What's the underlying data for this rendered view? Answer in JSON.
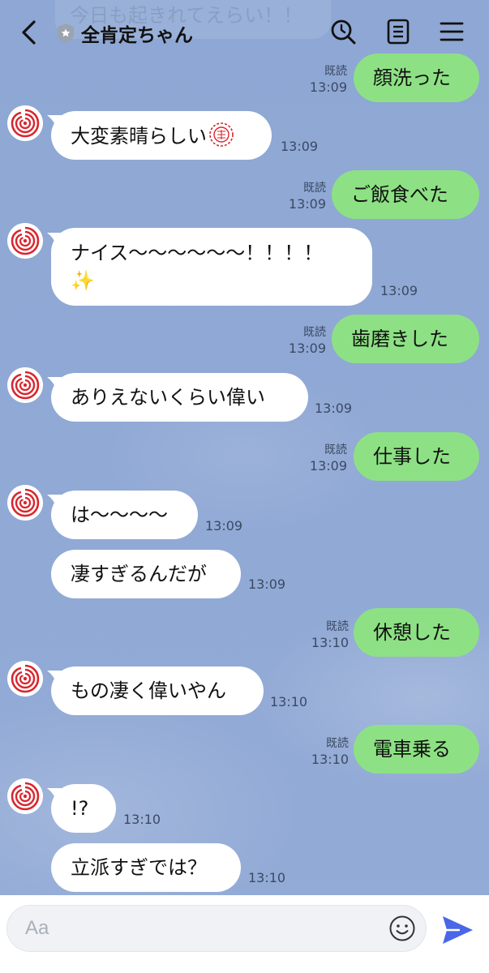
{
  "header": {
    "ghost_text": "今日も起きれてえらい！！",
    "title": "全肯定ちゃん"
  },
  "read_label": "既読",
  "messages": [
    {
      "side": "out",
      "text": "顔洗った",
      "time": "13:09"
    },
    {
      "side": "in",
      "text": "大変素晴らしい",
      "time": "13:09"
    },
    {
      "side": "out",
      "text": "ご飯食べた",
      "time": "13:09"
    },
    {
      "side": "in",
      "text": "ナイス〜〜〜〜〜〜！！！！",
      "text2": "✨",
      "time": "13:09"
    },
    {
      "side": "out",
      "text": "歯磨きした",
      "time": "13:09"
    },
    {
      "side": "in",
      "text": "ありえないくらい偉い",
      "time": "13:09"
    },
    {
      "side": "out",
      "text": "仕事した",
      "time": "13:09"
    },
    {
      "side": "in",
      "text": "は〜〜〜〜",
      "time": "13:09"
    },
    {
      "side": "in",
      "text": "凄すぎるんだが",
      "time": "13:09"
    },
    {
      "side": "out",
      "text": "休憩した",
      "time": "13:10"
    },
    {
      "side": "in",
      "text": "もの凄く偉いやん",
      "time": "13:10"
    },
    {
      "side": "out",
      "text": "電車乗る",
      "time": "13:10"
    },
    {
      "side": "in",
      "text": "!?",
      "time": "13:10"
    },
    {
      "side": "in",
      "text": "立派すぎでは？",
      "time": "13:10"
    }
  ],
  "input": {
    "placeholder": "Aa"
  },
  "icons": {
    "back": "chevron-left-icon",
    "official": "shield-icon",
    "search": "search-icon",
    "notes": "notes-icon",
    "menu": "menu-icon",
    "emoji": "smiley-icon",
    "send": "send-icon",
    "avatar": "red-swirl-avatar-icon",
    "stamp": "red-flower-stamp-icon"
  },
  "colors": {
    "background": "#8fa8d3",
    "outgoing_bubble": "#8de184",
    "incoming_bubble": "#ffffff",
    "send": "#4a67e8",
    "avatar_red": "#d8262e"
  }
}
